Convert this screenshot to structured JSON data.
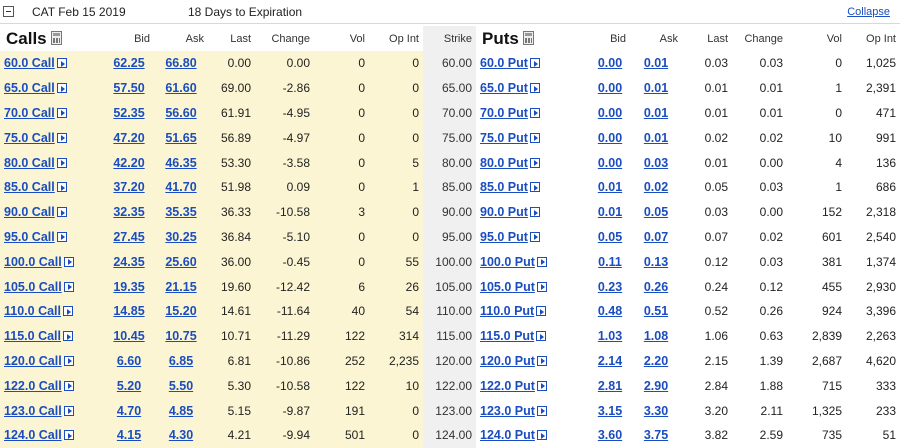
{
  "header": {
    "series": "CAT Feb 15 2019",
    "expiry_text": "18 Days to Expiration",
    "collapse_label": "Collapse"
  },
  "columns": {
    "calls_title": "Calls",
    "puts_title": "Puts",
    "bid": "Bid",
    "ask": "Ask",
    "last": "Last",
    "change": "Change",
    "vol": "Vol",
    "op_int": "Op Int",
    "strike": "Strike"
  },
  "icons": {
    "calculator": "calculator-icon",
    "detail_arrow": "arrow-right-box-icon"
  },
  "colors": {
    "link": "#1a4dbf",
    "calls_bg": "#fbf5d3",
    "strike_bg": "#f0f0f0"
  },
  "rows": [
    {
      "call": {
        "label": "60.0 Call",
        "bid": "62.25",
        "ask": "66.80",
        "last": "0.00",
        "change": "0.00",
        "vol": "0",
        "oi": "0"
      },
      "strike": "60.00",
      "put": {
        "label": "60.0 Put",
        "bid": "0.00",
        "ask": "0.01",
        "last": "0.03",
        "change": "0.03",
        "vol": "0",
        "oi": "1,025"
      }
    },
    {
      "call": {
        "label": "65.0 Call",
        "bid": "57.50",
        "ask": "61.60",
        "last": "69.00",
        "change": "-2.86",
        "vol": "0",
        "oi": "0"
      },
      "strike": "65.00",
      "put": {
        "label": "65.0 Put",
        "bid": "0.00",
        "ask": "0.01",
        "last": "0.01",
        "change": "0.01",
        "vol": "1",
        "oi": "2,391"
      }
    },
    {
      "call": {
        "label": "70.0 Call",
        "bid": "52.35",
        "ask": "56.60",
        "last": "61.91",
        "change": "-4.95",
        "vol": "0",
        "oi": "0"
      },
      "strike": "70.00",
      "put": {
        "label": "70.0 Put",
        "bid": "0.00",
        "ask": "0.01",
        "last": "0.01",
        "change": "0.01",
        "vol": "0",
        "oi": "471"
      }
    },
    {
      "call": {
        "label": "75.0 Call",
        "bid": "47.20",
        "ask": "51.65",
        "last": "56.89",
        "change": "-4.97",
        "vol": "0",
        "oi": "0"
      },
      "strike": "75.00",
      "put": {
        "label": "75.0 Put",
        "bid": "0.00",
        "ask": "0.01",
        "last": "0.02",
        "change": "0.02",
        "vol": "10",
        "oi": "991"
      }
    },
    {
      "call": {
        "label": "80.0 Call",
        "bid": "42.20",
        "ask": "46.35",
        "last": "53.30",
        "change": "-3.58",
        "vol": "0",
        "oi": "5"
      },
      "strike": "80.00",
      "put": {
        "label": "80.0 Put",
        "bid": "0.00",
        "ask": "0.03",
        "last": "0.01",
        "change": "0.00",
        "vol": "4",
        "oi": "136"
      }
    },
    {
      "call": {
        "label": "85.0 Call",
        "bid": "37.20",
        "ask": "41.70",
        "last": "51.98",
        "change": "0.09",
        "vol": "0",
        "oi": "1"
      },
      "strike": "85.00",
      "put": {
        "label": "85.0 Put",
        "bid": "0.01",
        "ask": "0.02",
        "last": "0.05",
        "change": "0.03",
        "vol": "1",
        "oi": "686"
      }
    },
    {
      "call": {
        "label": "90.0 Call",
        "bid": "32.35",
        "ask": "35.35",
        "last": "36.33",
        "change": "-10.58",
        "vol": "3",
        "oi": "0"
      },
      "strike": "90.00",
      "put": {
        "label": "90.0 Put",
        "bid": "0.01",
        "ask": "0.05",
        "last": "0.03",
        "change": "0.00",
        "vol": "152",
        "oi": "2,318"
      }
    },
    {
      "call": {
        "label": "95.0 Call",
        "bid": "27.45",
        "ask": "30.25",
        "last": "36.84",
        "change": "-5.10",
        "vol": "0",
        "oi": "0"
      },
      "strike": "95.00",
      "put": {
        "label": "95.0 Put",
        "bid": "0.05",
        "ask": "0.07",
        "last": "0.07",
        "change": "0.02",
        "vol": "601",
        "oi": "2,540"
      }
    },
    {
      "call": {
        "label": "100.0 Call",
        "bid": "24.35",
        "ask": "25.60",
        "last": "36.00",
        "change": "-0.45",
        "vol": "0",
        "oi": "55"
      },
      "strike": "100.00",
      "put": {
        "label": "100.0 Put",
        "bid": "0.11",
        "ask": "0.13",
        "last": "0.12",
        "change": "0.03",
        "vol": "381",
        "oi": "1,374"
      }
    },
    {
      "call": {
        "label": "105.0 Call",
        "bid": "19.35",
        "ask": "21.15",
        "last": "19.60",
        "change": "-12.42",
        "vol": "6",
        "oi": "26"
      },
      "strike": "105.00",
      "put": {
        "label": "105.0 Put",
        "bid": "0.23",
        "ask": "0.26",
        "last": "0.24",
        "change": "0.12",
        "vol": "455",
        "oi": "2,930"
      }
    },
    {
      "call": {
        "label": "110.0 Call",
        "bid": "14.85",
        "ask": "15.20",
        "last": "14.61",
        "change": "-11.64",
        "vol": "40",
        "oi": "54"
      },
      "strike": "110.00",
      "put": {
        "label": "110.0 Put",
        "bid": "0.48",
        "ask": "0.51",
        "last": "0.52",
        "change": "0.26",
        "vol": "924",
        "oi": "3,396"
      }
    },
    {
      "call": {
        "label": "115.0 Call",
        "bid": "10.45",
        "ask": "10.75",
        "last": "10.71",
        "change": "-11.29",
        "vol": "122",
        "oi": "314"
      },
      "strike": "115.00",
      "put": {
        "label": "115.0 Put",
        "bid": "1.03",
        "ask": "1.08",
        "last": "1.06",
        "change": "0.63",
        "vol": "2,839",
        "oi": "2,263"
      }
    },
    {
      "call": {
        "label": "120.0 Call",
        "bid": "6.60",
        "ask": "6.85",
        "last": "6.81",
        "change": "-10.86",
        "vol": "252",
        "oi": "2,235"
      },
      "strike": "120.00",
      "put": {
        "label": "120.0 Put",
        "bid": "2.14",
        "ask": "2.20",
        "last": "2.15",
        "change": "1.39",
        "vol": "2,687",
        "oi": "4,620"
      }
    },
    {
      "call": {
        "label": "122.0 Call",
        "bid": "5.20",
        "ask": "5.50",
        "last": "5.30",
        "change": "-10.58",
        "vol": "122",
        "oi": "10"
      },
      "strike": "122.00",
      "put": {
        "label": "122.0 Put",
        "bid": "2.81",
        "ask": "2.90",
        "last": "2.84",
        "change": "1.88",
        "vol": "715",
        "oi": "333"
      }
    },
    {
      "call": {
        "label": "123.0 Call",
        "bid": "4.70",
        "ask": "4.85",
        "last": "5.15",
        "change": "-9.87",
        "vol": "191",
        "oi": "0"
      },
      "strike": "123.00",
      "put": {
        "label": "123.0 Put",
        "bid": "3.15",
        "ask": "3.30",
        "last": "3.20",
        "change": "2.11",
        "vol": "1,325",
        "oi": "233"
      }
    },
    {
      "call": {
        "label": "124.0 Call",
        "bid": "4.15",
        "ask": "4.30",
        "last": "4.21",
        "change": "-9.94",
        "vol": "501",
        "oi": "0"
      },
      "strike": "124.00",
      "put": {
        "label": "124.0 Put",
        "bid": "3.60",
        "ask": "3.75",
        "last": "3.82",
        "change": "2.59",
        "vol": "735",
        "oi": "51"
      }
    }
  ]
}
